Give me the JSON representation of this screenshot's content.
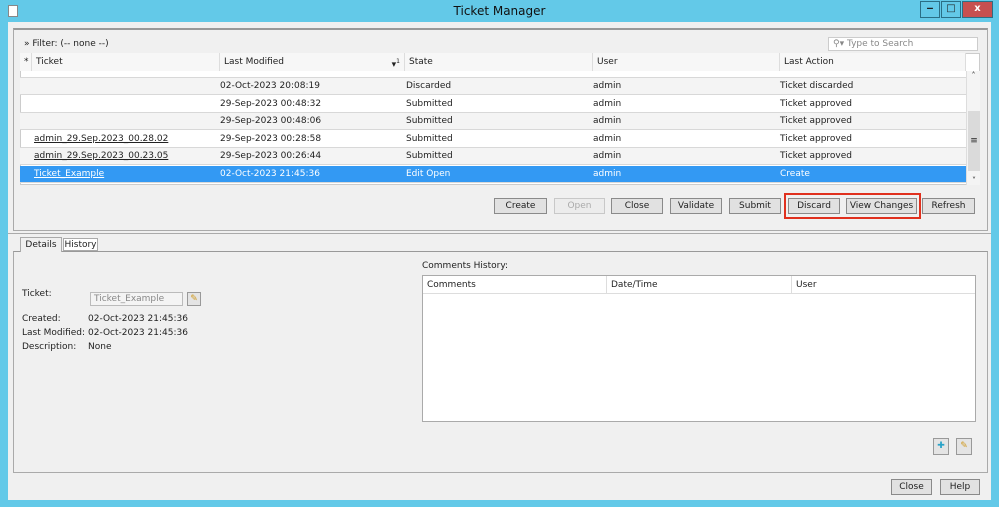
{
  "window": {
    "title": "Ticket Manager",
    "minimize": "‒",
    "maximize": "□",
    "close": "x"
  },
  "filter": {
    "label": "Filter: (-- none --)",
    "search_placeholder": "Type to Search"
  },
  "table": {
    "columns": [
      "*",
      "Ticket",
      "Last Modified",
      "State",
      "User",
      "Last Action"
    ],
    "sort_indicator": "1",
    "rows": [
      {
        "ticket": "",
        "modified": "02-Oct-2023 20:08:19",
        "state": "Discarded",
        "user": "admin",
        "action": "Ticket discarded"
      },
      {
        "ticket": "",
        "modified": "29-Sep-2023 00:48:32",
        "state": "Submitted",
        "user": "admin",
        "action": "Ticket approved"
      },
      {
        "ticket": "",
        "modified": "29-Sep-2023 00:48:06",
        "state": "Submitted",
        "user": "admin",
        "action": "Ticket approved"
      },
      {
        "ticket": "admin_29.Sep.2023_00.28.02",
        "modified": "29-Sep-2023 00:28:58",
        "state": "Submitted",
        "user": "admin",
        "action": "Ticket approved"
      },
      {
        "ticket": "admin_29.Sep.2023_00.23.05",
        "modified": "29-Sep-2023 00:26:44",
        "state": "Submitted",
        "user": "admin",
        "action": "Ticket approved"
      },
      {
        "ticket": "Ticket_Example",
        "modified": "02-Oct-2023 21:45:36",
        "state": "Edit Open",
        "user": "admin",
        "action": "Create"
      }
    ]
  },
  "buttons": {
    "create": "Create",
    "open": "Open",
    "close": "Close",
    "validate": "Validate",
    "submit": "Submit",
    "discard": "Discard",
    "view_changes": "View Changes",
    "refresh": "Refresh"
  },
  "tabs": {
    "details": "Details",
    "history": "History"
  },
  "details": {
    "ticket_label": "Ticket:",
    "ticket_value": "Ticket_Example",
    "created_label": "Created:",
    "created_value": "02-Oct-2023 21:45:36",
    "modified_label": "Last Modified:",
    "modified_value": "02-Oct-2023 21:45:36",
    "description_label": "Description:",
    "description_value": "None"
  },
  "comments": {
    "label": "Comments History:",
    "columns": [
      "Comments",
      "Date/Time",
      "User"
    ]
  },
  "footer": {
    "close": "Close",
    "help": "Help"
  },
  "colors": {
    "titlebar": "#63c9e8",
    "selection": "#3399f3",
    "highlight": "#e0301e"
  }
}
